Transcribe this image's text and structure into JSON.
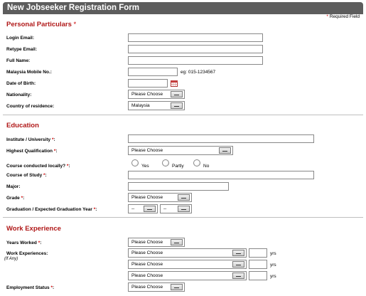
{
  "form": {
    "title": "New Jobseeker Registration Form",
    "required_note": "Required Field",
    "required_mark": "*"
  },
  "personal": {
    "heading": "Personal Particulars",
    "login_email_label": "Login Email:",
    "retype_email_label": "Retype Email:",
    "full_name_label": "Full Name:",
    "mobile_label": "Malaysia Mobile No.:",
    "mobile_example": "eg: 015-1234567",
    "dob_label": "Date of Birth:",
    "nationality_label": "Nationality:",
    "nationality_value": "Please Choose",
    "country_label": "Country of residence:",
    "country_value": "Malaysia"
  },
  "education": {
    "heading": "Education",
    "institute_label": "Institute / University",
    "qualification_label": "Highest Qualification",
    "qualification_value": "Please Choose",
    "local_label": "Course conducted locally?",
    "radio_yes": "Yes",
    "radio_partly": "Partly",
    "radio_no": "No",
    "course_label": "Course of Study",
    "major_label": "Major:",
    "grade_label": "Grade",
    "grade_value": "Please Choose",
    "graduation_label": "Graduation / Expected Graduation Year",
    "grad_month_value": "--",
    "grad_year_value": "--"
  },
  "work": {
    "heading": "Work Experience",
    "years_label": "Years Worked",
    "years_value": "Please Choose",
    "experiences_label": "Work Experiences:",
    "experiences_sub": "(If Any)",
    "experience_rows": [
      {
        "value": "Please Choose",
        "unit": "yrs"
      },
      {
        "value": "Please Choose",
        "unit": "yrs"
      },
      {
        "value": "Please Choose",
        "unit": "yrs"
      }
    ],
    "status_label": "Employment Status",
    "status_value": "Please Choose"
  }
}
